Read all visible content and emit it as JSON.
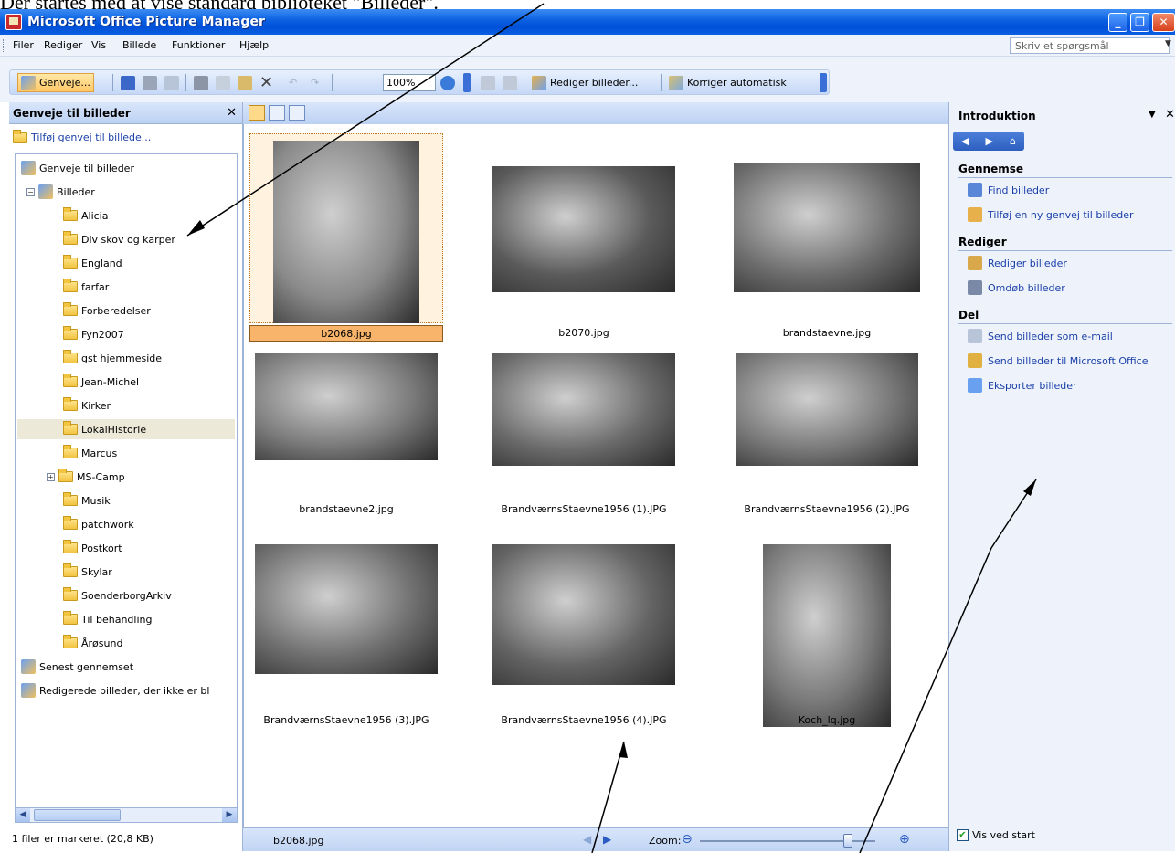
{
  "caption": "Der startes med at vise standard biblioteket \"Billeder\".",
  "window": {
    "title": "Microsoft Office Picture Manager",
    "buttons": {
      "minimize": "_",
      "maximize": "❐",
      "close": "✕"
    }
  },
  "menu": {
    "items": [
      "Filer",
      "Rediger",
      "Vis",
      "Billede",
      "Funktioner",
      "Hjælp"
    ],
    "ask_placeholder": "Skriv et spørgsmål"
  },
  "toolbar": {
    "shortcuts_label": "Genveje...",
    "zoom_value": "100%",
    "edit_pictures_label": "Rediger billeder...",
    "auto_correct_label": "Korriger automatisk"
  },
  "left_pane": {
    "title": "Genveje til billeder",
    "add_shortcut": "Tilføj genvej til billede...",
    "tree": [
      {
        "label": "Genveje til billeder",
        "level": 0,
        "kind": "root"
      },
      {
        "label": "Billeder",
        "level": 1,
        "kind": "library",
        "toggle": "−"
      },
      {
        "label": "Alicia",
        "level": 2,
        "kind": "folder"
      },
      {
        "label": "Div skov og karper",
        "level": 2,
        "kind": "folder"
      },
      {
        "label": "England",
        "level": 2,
        "kind": "folder"
      },
      {
        "label": "farfar",
        "level": 2,
        "kind": "folder"
      },
      {
        "label": "Forberedelser",
        "level": 2,
        "kind": "folder"
      },
      {
        "label": "Fyn2007",
        "level": 2,
        "kind": "folder"
      },
      {
        "label": "gst hjemmeside",
        "level": 2,
        "kind": "folder"
      },
      {
        "label": "Jean-Michel",
        "level": 2,
        "kind": "folder"
      },
      {
        "label": "Kirker",
        "level": 2,
        "kind": "folder"
      },
      {
        "label": "LokalHistorie",
        "level": 2,
        "kind": "folder",
        "selected": true
      },
      {
        "label": "Marcus",
        "level": 2,
        "kind": "folder"
      },
      {
        "label": "MS-Camp",
        "level": 2,
        "kind": "folder",
        "toggle": "+"
      },
      {
        "label": "Musik",
        "level": 2,
        "kind": "folder"
      },
      {
        "label": "patchwork",
        "level": 2,
        "kind": "folder"
      },
      {
        "label": "Postkort",
        "level": 2,
        "kind": "folder"
      },
      {
        "label": "Skylar",
        "level": 2,
        "kind": "folder"
      },
      {
        "label": "SoenderborgArkiv",
        "level": 2,
        "kind": "folder"
      },
      {
        "label": "Til behandling",
        "level": 2,
        "kind": "folder"
      },
      {
        "label": "Årøsund",
        "level": 2,
        "kind": "folder"
      },
      {
        "label": "Senest gennemset",
        "level": 0,
        "kind": "special"
      },
      {
        "label": "Redigerede billeder, der ikke er bl",
        "level": 0,
        "kind": "special"
      }
    ],
    "status": "1 filer er markeret (20,8 KB)"
  },
  "thumbnails": [
    {
      "name": "b2068.jpg",
      "selected": true,
      "tone": "#8a8a8a"
    },
    {
      "name": "b2070.jpg",
      "tone": "#5a5a5a"
    },
    {
      "name": "brandstaevne.jpg",
      "tone": "#6e6e6e"
    },
    {
      "name": "brandstaevne2.jpg",
      "tone": "#7a7a7a"
    },
    {
      "name": "BrandværnsStaevne1956 (1).JPG",
      "tone": "#6a6a6a"
    },
    {
      "name": "BrandværnsStaevne1956 (2).JPG",
      "tone": "#777777"
    },
    {
      "name": "BrandværnsStaevne1956 (3).JPG",
      "tone": "#707070"
    },
    {
      "name": "BrandværnsStaevne1956 (4).JPG",
      "tone": "#646464"
    },
    {
      "name": "Koch_lq.jpg",
      "tone": "#807868"
    }
  ],
  "center_status": {
    "current_file": "b2068.jpg",
    "zoom_label": "Zoom:",
    "zoom_level": 0.86
  },
  "task_pane": {
    "title": "Introduktion",
    "sections": [
      {
        "heading": "Gennemse",
        "links": [
          "Find billeder",
          "Tilføj en ny genvej til billeder"
        ]
      },
      {
        "heading": "Rediger",
        "links": [
          "Rediger billeder",
          "Omdøb billeder"
        ]
      },
      {
        "heading": "Del",
        "links": [
          "Send billeder som e-mail",
          "Send billeder til Microsoft Office",
          "Eksporter billeder"
        ]
      }
    ],
    "show_at_startup": "Vis ved start"
  },
  "colors": {
    "titlebar": "#0a5fe0",
    "selection": "#f7b46a",
    "link": "#1a3fa8",
    "pane_bg": "#eef3fb"
  }
}
